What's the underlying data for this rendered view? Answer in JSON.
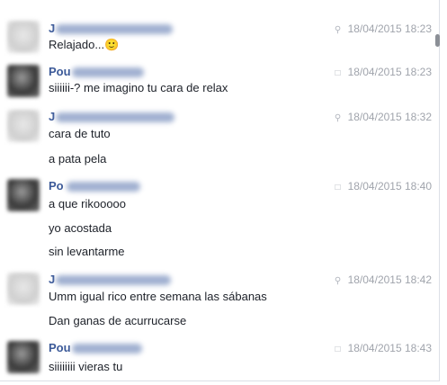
{
  "messages": [
    {
      "name": "J",
      "icon": "location-icon",
      "time": "18/04/2015 18:23",
      "lines": [
        "Relajado...🙂"
      ]
    },
    {
      "name": "Pou",
      "icon": "chat-icon",
      "time": "18/04/2015 18:23",
      "lines": [
        "siiiiii-? me imagino tu cara de relax"
      ]
    },
    {
      "name": "J",
      "icon": "location-icon",
      "time": "18/04/2015 18:32",
      "lines": [
        "cara de tuto",
        "a pata pela"
      ]
    },
    {
      "name": "Po",
      "icon": "chat-icon",
      "time": "18/04/2015 18:40",
      "lines": [
        "a que rikooooo",
        "yo acostada",
        "sin levantarme"
      ]
    },
    {
      "name": "J",
      "icon": "location-icon",
      "time": "18/04/2015 18:42",
      "lines": [
        "Umm  igual rico entre semana las sábanas",
        "Dan ganas de acurrucarse"
      ]
    },
    {
      "name": "Pou",
      "icon": "chat-icon",
      "time": "18/04/2015 18:43",
      "lines": [
        "siiiiiiii vieras tu"
      ]
    }
  ]
}
